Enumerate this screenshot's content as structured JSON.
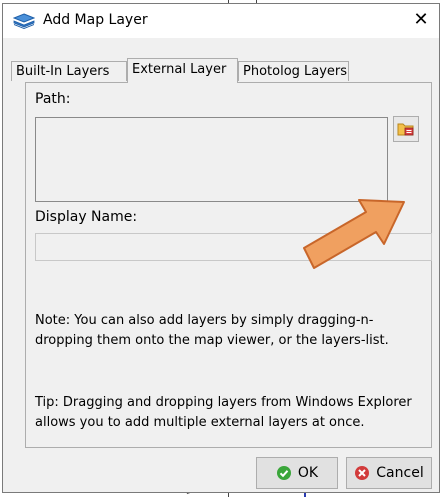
{
  "window": {
    "title": "Add Map Layer",
    "close_glyph": "✕",
    "title_icon": "map-layers-icon"
  },
  "tabs": [
    {
      "label": "Built-In Layers",
      "active": false
    },
    {
      "label": "External Layer",
      "active": true
    },
    {
      "label": "Photolog Layers",
      "active": false
    }
  ],
  "form": {
    "path_label": "Path:",
    "path_value": "",
    "browse_icon": "folder-browse-icon",
    "display_name_label": "Display Name:",
    "display_name_value": ""
  },
  "notes": {
    "note": "Note: You can also add layers by simply dragging-n-dropping them onto the map viewer, or the layers-list.",
    "tip": "Tip: Dragging and dropping layers from Windows Explorer allows you to add multiple external layers at once."
  },
  "buttons": {
    "ok_label": "OK",
    "cancel_label": "Cancel",
    "ok_icon": "check-icon",
    "cancel_icon": "cancel-x-icon"
  },
  "colors": {
    "arrow_fill": "#f0a060",
    "arrow_stroke": "#c8662a",
    "ok_green": "#3aa63a",
    "cancel_red": "#d23b3b"
  }
}
